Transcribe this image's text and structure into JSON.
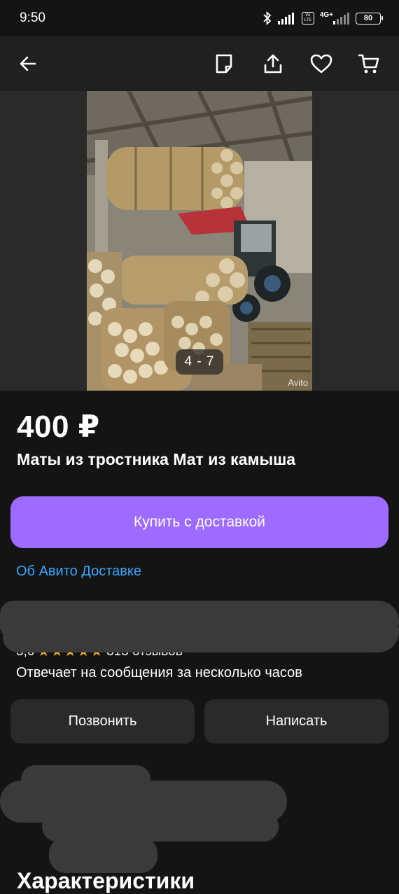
{
  "status_bar": {
    "time": "9:50",
    "network_label": "4G+",
    "volte_label": "Vo LTE",
    "battery": "80"
  },
  "top_bar": {
    "icons": [
      "back-arrow-icon",
      "note-icon",
      "share-icon",
      "heart-icon",
      "cart-icon"
    ]
  },
  "gallery": {
    "counter": "4 - 7",
    "watermark": "Avito"
  },
  "listing": {
    "price": "400 ₽",
    "title": "Маты из тростника Мат из камыша",
    "buy_label": "Купить с доставкой",
    "delivery_link": "Об Авито Доставке"
  },
  "seller": {
    "rating": "5,0",
    "stars": "★★★★★",
    "reviews": "315 отзывов",
    "reply_time": "Отвечает на сообщения за несколько часов",
    "call_label": "Позвонить",
    "write_label": "Написать"
  },
  "sections": {
    "characteristics": "Характеристики"
  },
  "colors": {
    "accent_purple": "#9d6bff",
    "link_blue": "#3aa6ff",
    "star_orange": "#ffb021",
    "background": "#141414"
  }
}
